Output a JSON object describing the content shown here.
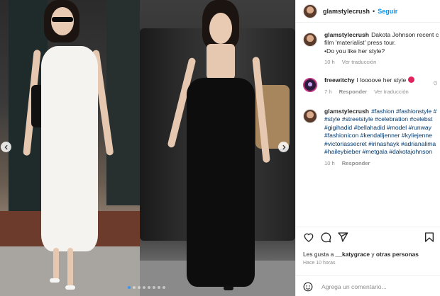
{
  "header": {
    "username": "glamstylecrush",
    "separator": "•",
    "follow_label": "Seguir"
  },
  "comments": [
    {
      "username": "glamstylecrush",
      "lines": [
        "Dakota Johnson recent c",
        "film 'materialist' press tour.",
        "•Do you like her style?"
      ],
      "time": "10 h",
      "action": "Ver traducción"
    },
    {
      "username": "freewitchy",
      "lines": [
        "I loooove her style"
      ],
      "time": "7 h",
      "reply": "Responder",
      "action": "Ver traducción"
    },
    {
      "username": "glamstylecrush",
      "lines": [
        "#fashion #fashionstyle #",
        "#style #streetstyle #celebration #celebst",
        "#gigihadid #bellahadid #model #runway",
        "#fashionicon #kendalljenner #kyliejenne",
        "#victoriassecret #irinashayk #adrianalima",
        "#haileybieber #metgala #dakotajohnson"
      ],
      "time": "10 h",
      "reply": "Responder"
    }
  ],
  "actions": {
    "likes_prefix": "Les gusta a",
    "likes_user": "__katygrace",
    "likes_and": "y",
    "likes_others": "otras personas",
    "time_ago": "Hace 10 horas"
  },
  "composer": {
    "placeholder": "Agrega un comentario..."
  },
  "icons": {
    "like": "heart-icon",
    "comment": "comment-icon",
    "share": "share-icon",
    "save": "bookmark-icon",
    "emoji": "emoji-icon",
    "prev": "chevron-left-icon",
    "next": "chevron-right-icon"
  },
  "colors": {
    "follow": "#0095f6",
    "hashtag": "#00376b",
    "muted": "#8e8e8e"
  }
}
